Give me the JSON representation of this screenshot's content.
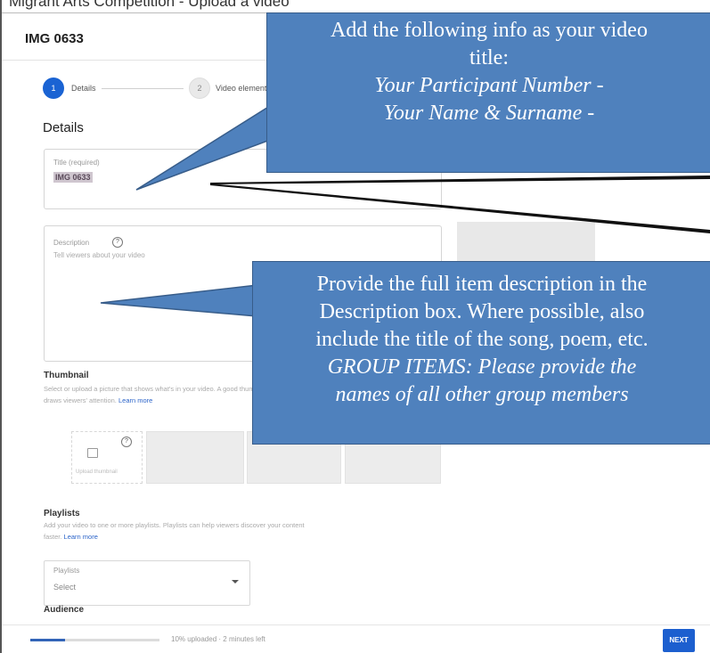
{
  "page": {
    "cropped_text": "Migrant Arts Competition - Upload a video"
  },
  "dialog": {
    "title": "IMG 0633",
    "steps": [
      {
        "number": "1",
        "label": "Details"
      },
      {
        "number": "2",
        "label": "Video elements"
      }
    ],
    "details_heading": "Details",
    "title_field": {
      "label": "Title (required)",
      "value": "IMG 0633"
    },
    "description_field": {
      "label": "Description",
      "placeholder": "Tell viewers about your video"
    },
    "help_icon_glyph": "?",
    "thumbnail": {
      "heading": "Thumbnail",
      "text_line1": "Select or upload a picture that shows what's in your video. A good thumbnail stands out and",
      "text_line2": "draws viewers' attention.",
      "learn_more": "Learn more",
      "upload_label": "Upload thumbnail"
    },
    "playlists": {
      "heading": "Playlists",
      "text_line1": "Add your video to one or more playlists. Playlists can help viewers discover your content",
      "text_line2": "faster.",
      "learn_more": "Learn more",
      "select_label": "Playlists",
      "select_value": "Select"
    },
    "audience_heading": "Audience",
    "footer": {
      "status": "10% uploaded · 2 minutes left",
      "progress_fraction": 0.1,
      "next_label": "NEXT"
    }
  },
  "callouts": {
    "title_callout": {
      "line1": "Add the following info as your video",
      "line2": "title:",
      "line3": "Your Participant Number -",
      "line4": "Your Name & Surname -"
    },
    "description_callout": {
      "line1": "Provide the full item description in the",
      "line2": "Description box.  Where possible, also",
      "line3": "include the title of the song, poem, etc.",
      "line4": "GROUP ITEMS: Please provide the",
      "line5": "names of all other group members"
    }
  },
  "colors": {
    "callout_fill": "#4f81bd",
    "callout_border": "#385d8a",
    "accent": "#1c5fcf"
  }
}
